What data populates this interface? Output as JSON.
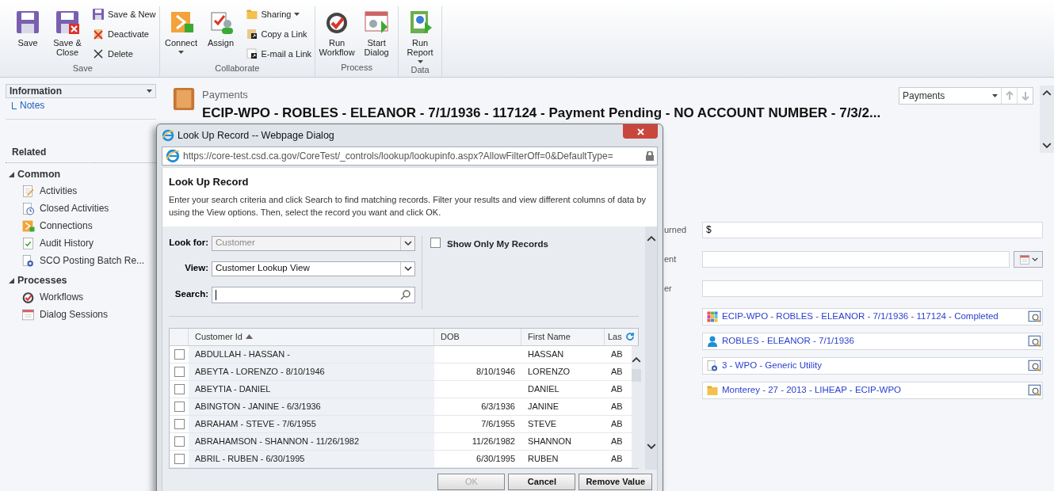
{
  "ribbon": {
    "groups": [
      {
        "label": "Save",
        "items": [
          {
            "label": "Save",
            "kind": "large",
            "dropdown": false
          },
          {
            "label": "Save & Close",
            "kind": "large",
            "dropdown": false
          },
          {
            "label": "Save & New",
            "kind": "small",
            "dropdown": false
          },
          {
            "label": "Deactivate",
            "kind": "small",
            "dropdown": false
          },
          {
            "label": "Delete",
            "kind": "small",
            "dropdown": false
          }
        ]
      },
      {
        "label": "Collaborate",
        "items": [
          {
            "label": "Connect",
            "kind": "large",
            "dropdown": true
          },
          {
            "label": "Assign",
            "kind": "large",
            "dropdown": false
          },
          {
            "label": "Sharing",
            "kind": "small",
            "dropdown": true
          },
          {
            "label": "Copy a Link",
            "kind": "small",
            "dropdown": false
          },
          {
            "label": "E-mail a Link",
            "kind": "small",
            "dropdown": false
          }
        ]
      },
      {
        "label": "Process",
        "items": [
          {
            "label": "Run Workflow",
            "kind": "large",
            "dropdown": false
          },
          {
            "label": "Start Dialog",
            "kind": "large",
            "dropdown": false
          }
        ]
      },
      {
        "label": "Data",
        "items": [
          {
            "label": "Run Report",
            "kind": "large",
            "dropdown": true
          }
        ]
      }
    ]
  },
  "sidebar": {
    "section_select": "Information",
    "links": [
      "Notes"
    ],
    "related_heading": "Related",
    "groups": [
      {
        "label": "Common",
        "expanded": true,
        "items": [
          "Activities",
          "Closed Activities",
          "Connections",
          "Audit History",
          "SCO Posting Batch Re..."
        ]
      },
      {
        "label": "Processes",
        "expanded": true,
        "items": [
          "Workflows",
          "Dialog Sessions"
        ]
      }
    ]
  },
  "header": {
    "entity": "Payments",
    "title": "ECIP-WPO - ROBLES - ELEANOR - 7/1/1936 - 117124 - Payment Pending - NO ACCOUNT NUMBER - 7/3/2...",
    "record_select": "Payments"
  },
  "form": {
    "fields": [
      {
        "label": "urned",
        "value": "$",
        "kind": "text"
      },
      {
        "label": "ent",
        "kind": "date"
      },
      {
        "label": "er",
        "kind": "text"
      }
    ],
    "lookups": [
      "ECIP-WPO - ROBLES - ELEANOR - 7/1/1936 - 117124 - Completed",
      "ROBLES - ELEANOR - 7/1/1936",
      "3 - WPO - Generic Utility",
      "Monterey - 27 - 2013 - LIHEAP - ECIP-WPO"
    ]
  },
  "dialog": {
    "title": "Look Up Record -- Webpage Dialog",
    "url": "https://core-test.csd.ca.gov/CoreTest/_controls/lookup/lookupinfo.aspx?AllowFilterOff=0&DefaultType=",
    "heading": "Look Up Record",
    "description": "Enter your search criteria and click Search to find matching records. Filter your results and view different columns of data by using the View options. Then, select the record you want and click OK.",
    "look_for": {
      "label": "Look for:",
      "value": "Customer",
      "disabled": true
    },
    "view": {
      "label": "View:",
      "value": "Customer Lookup View"
    },
    "search": {
      "label": "Search:"
    },
    "show_only_mine": {
      "label": "Show Only My Records",
      "checked": false
    },
    "table": {
      "columns": [
        {
          "label": "Customer Id",
          "sorted": true
        },
        {
          "label": "DOB",
          "sorted": false
        },
        {
          "label": "First Name",
          "sorted": false
        },
        {
          "label": "Las",
          "sorted": false
        }
      ],
      "rows": [
        {
          "checked": false,
          "cells": [
            "ABDULLAH - HASSAN -",
            null,
            "HASSAN",
            "AB"
          ]
        },
        {
          "checked": false,
          "cells": [
            "ABEYTA - LORENZO - 8/10/1946",
            "8/10/1946",
            "LORENZO",
            "AB"
          ]
        },
        {
          "checked": false,
          "cells": [
            "ABEYTIA - DANIEL",
            null,
            "DANIEL",
            "AB"
          ]
        },
        {
          "checked": false,
          "cells": [
            "ABINGTON - JANINE - 6/3/1936",
            "6/3/1936",
            "JANINE",
            "AB"
          ]
        },
        {
          "checked": false,
          "cells": [
            "ABRAHAM - STEVE - 7/6/1955",
            "7/6/1955",
            "STEVE",
            "AB"
          ]
        },
        {
          "checked": false,
          "cells": [
            "ABRAHAMSON - SHANNON - 11/26/1982",
            "11/26/1982",
            "SHANNON",
            "AB"
          ]
        },
        {
          "checked": false,
          "cells": [
            "ABRIL - RUBEN - 6/30/1995",
            "6/30/1995",
            "RUBEN",
            "AB"
          ]
        }
      ]
    },
    "buttons": [
      {
        "label": "OK",
        "disabled": true
      },
      {
        "label": "Cancel",
        "disabled": false
      },
      {
        "label": "Remove Value",
        "disabled": false
      }
    ]
  }
}
